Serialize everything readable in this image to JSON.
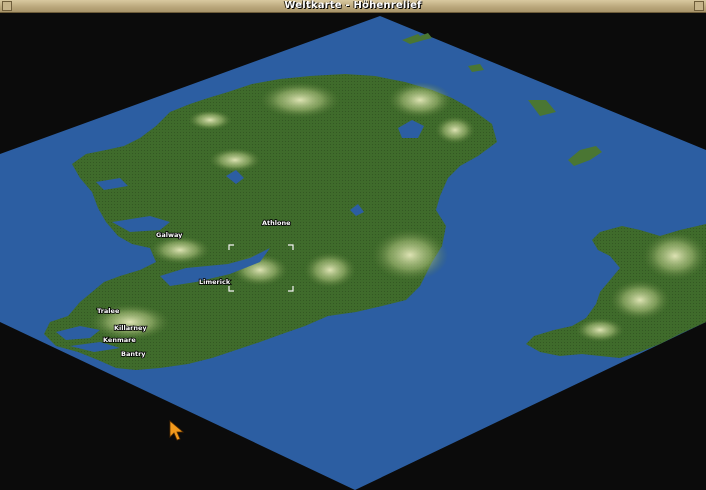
{
  "window": {
    "title": "Weltkarte - Höhenrelief"
  },
  "map": {
    "colors": {
      "background": "#0b0b0b",
      "water": "#2c5ea2",
      "lowland": "#3e6a2a",
      "highland": "#b8c98a",
      "peak": "#e8ebc0"
    },
    "towns": [
      "Athlone",
      "Galway",
      "Limerick",
      "Tralee",
      "Killarney",
      "Kenmare",
      "Bantry"
    ]
  },
  "cursor": {
    "icon": "arrow-cursor-icon"
  }
}
